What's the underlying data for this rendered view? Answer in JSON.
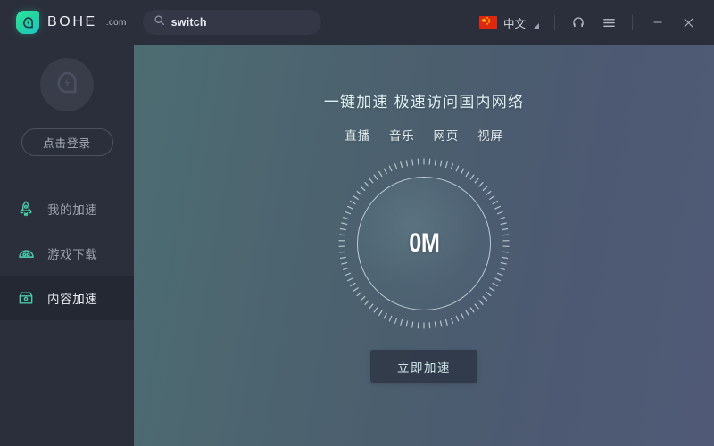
{
  "titlebar": {
    "brand_name": "BOHE",
    "brand_tld": ".com",
    "brand_icon": "bohe-leaf-logo-icon",
    "search": {
      "icon": "search-icon",
      "value": "switch",
      "placeholder": "switch"
    },
    "language": {
      "flag_icon": "china-flag-icon",
      "label": "中文",
      "caret_icon": "caret-down-icon"
    },
    "support_icon": "headset-icon",
    "menu_icon": "hamburger-menu-icon",
    "minimize_label": "–",
    "minimize_icon": "minimize-icon",
    "close_label": "✕",
    "close_icon": "close-icon"
  },
  "sidebar": {
    "avatar_icon": "default-avatar-icon",
    "login_label": "点击登录",
    "items": [
      {
        "label": "我的加速",
        "icon": "rocket-icon",
        "active": false
      },
      {
        "label": "游戏下载",
        "icon": "game-alien-icon",
        "active": false
      },
      {
        "label": "内容加速",
        "icon": "content-box-icon",
        "active": true
      }
    ]
  },
  "main": {
    "title": "一键加速 极速访问国内网络",
    "tabs": [
      {
        "label": "直播"
      },
      {
        "label": "音乐"
      },
      {
        "label": "网页"
      },
      {
        "label": "视屏"
      }
    ],
    "gauge": {
      "value": "0M",
      "unit": "M",
      "number": 0
    },
    "cta_label": "立即加速"
  },
  "colors": {
    "accent_green": "#2ee6a8",
    "sidebar_bg": "#2b2f3b",
    "active_item_bg": "#242832",
    "main_gradient_start": "#4c6d72",
    "main_gradient_end": "#505a77",
    "flag_red": "#de2910"
  }
}
